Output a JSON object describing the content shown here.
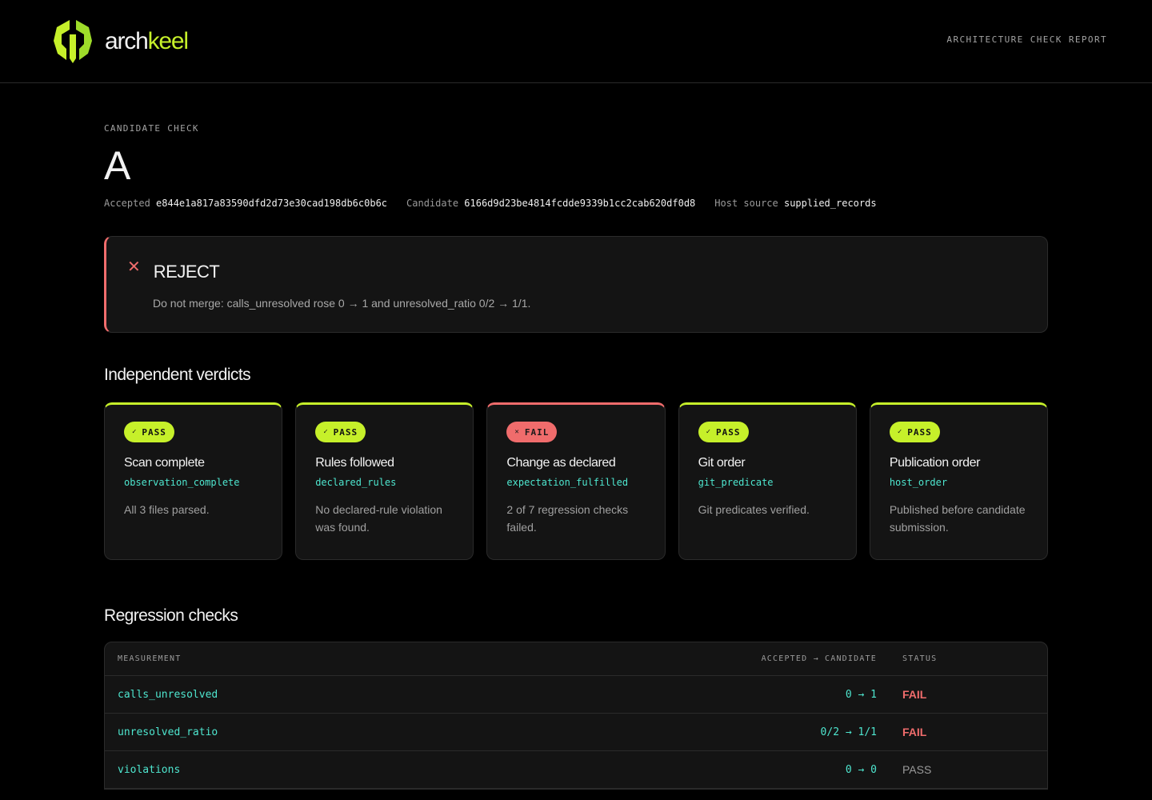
{
  "brand": {
    "name_prefix": "arch",
    "name_suffix": "keel",
    "accent": "#c6f02a"
  },
  "header": {
    "report_label": "ARCHITECTURE CHECK REPORT"
  },
  "candidate": {
    "eyebrow": "CANDIDATE CHECK",
    "name": "A",
    "meta": [
      {
        "key": "Accepted",
        "value": "e844e1a817a83590dfd2d73e30cad198db6c0b6c"
      },
      {
        "key": "Candidate",
        "value": "6166d9d23be4814fcdde9339b1cc2cab620df0d8"
      },
      {
        "key": "Host source",
        "value": "supplied_records"
      }
    ]
  },
  "decision": {
    "icon": "close-icon",
    "glyph": "✕",
    "title": "REJECT",
    "message": "Do not merge: calls_unresolved rose 0 → 1 and unresolved_ratio 0/2 → 1/1.",
    "color": "#f06c6c"
  },
  "verdicts": {
    "title": "Independent verdicts",
    "items": [
      {
        "status": "PASS",
        "icon": "✓",
        "title": "Scan complete",
        "code": "observation_complete",
        "desc": "All 3 files parsed."
      },
      {
        "status": "PASS",
        "icon": "✓",
        "title": "Rules followed",
        "code": "declared_rules",
        "desc": "No declared-rule violation was found."
      },
      {
        "status": "FAIL",
        "icon": "✕",
        "title": "Change as declared",
        "code": "expectation_fulfilled",
        "desc": "2 of 7 regression checks failed."
      },
      {
        "status": "PASS",
        "icon": "✓",
        "title": "Git order",
        "code": "git_predicate",
        "desc": "Git predicates verified."
      },
      {
        "status": "PASS",
        "icon": "✓",
        "title": "Publication order",
        "code": "host_order",
        "desc": "Published before candidate submission."
      }
    ]
  },
  "regression": {
    "title": "Regression checks",
    "columns": {
      "measurement": "MEASUREMENT",
      "change": "ACCEPTED → CANDIDATE",
      "status": "STATUS"
    },
    "rows": [
      {
        "measurement": "calls_unresolved",
        "change": "0 → 1",
        "status": "FAIL"
      },
      {
        "measurement": "unresolved_ratio",
        "change": "0/2 → 1/1",
        "status": "FAIL"
      },
      {
        "measurement": "violations",
        "change": "0 → 0",
        "status": "PASS"
      }
    ]
  }
}
